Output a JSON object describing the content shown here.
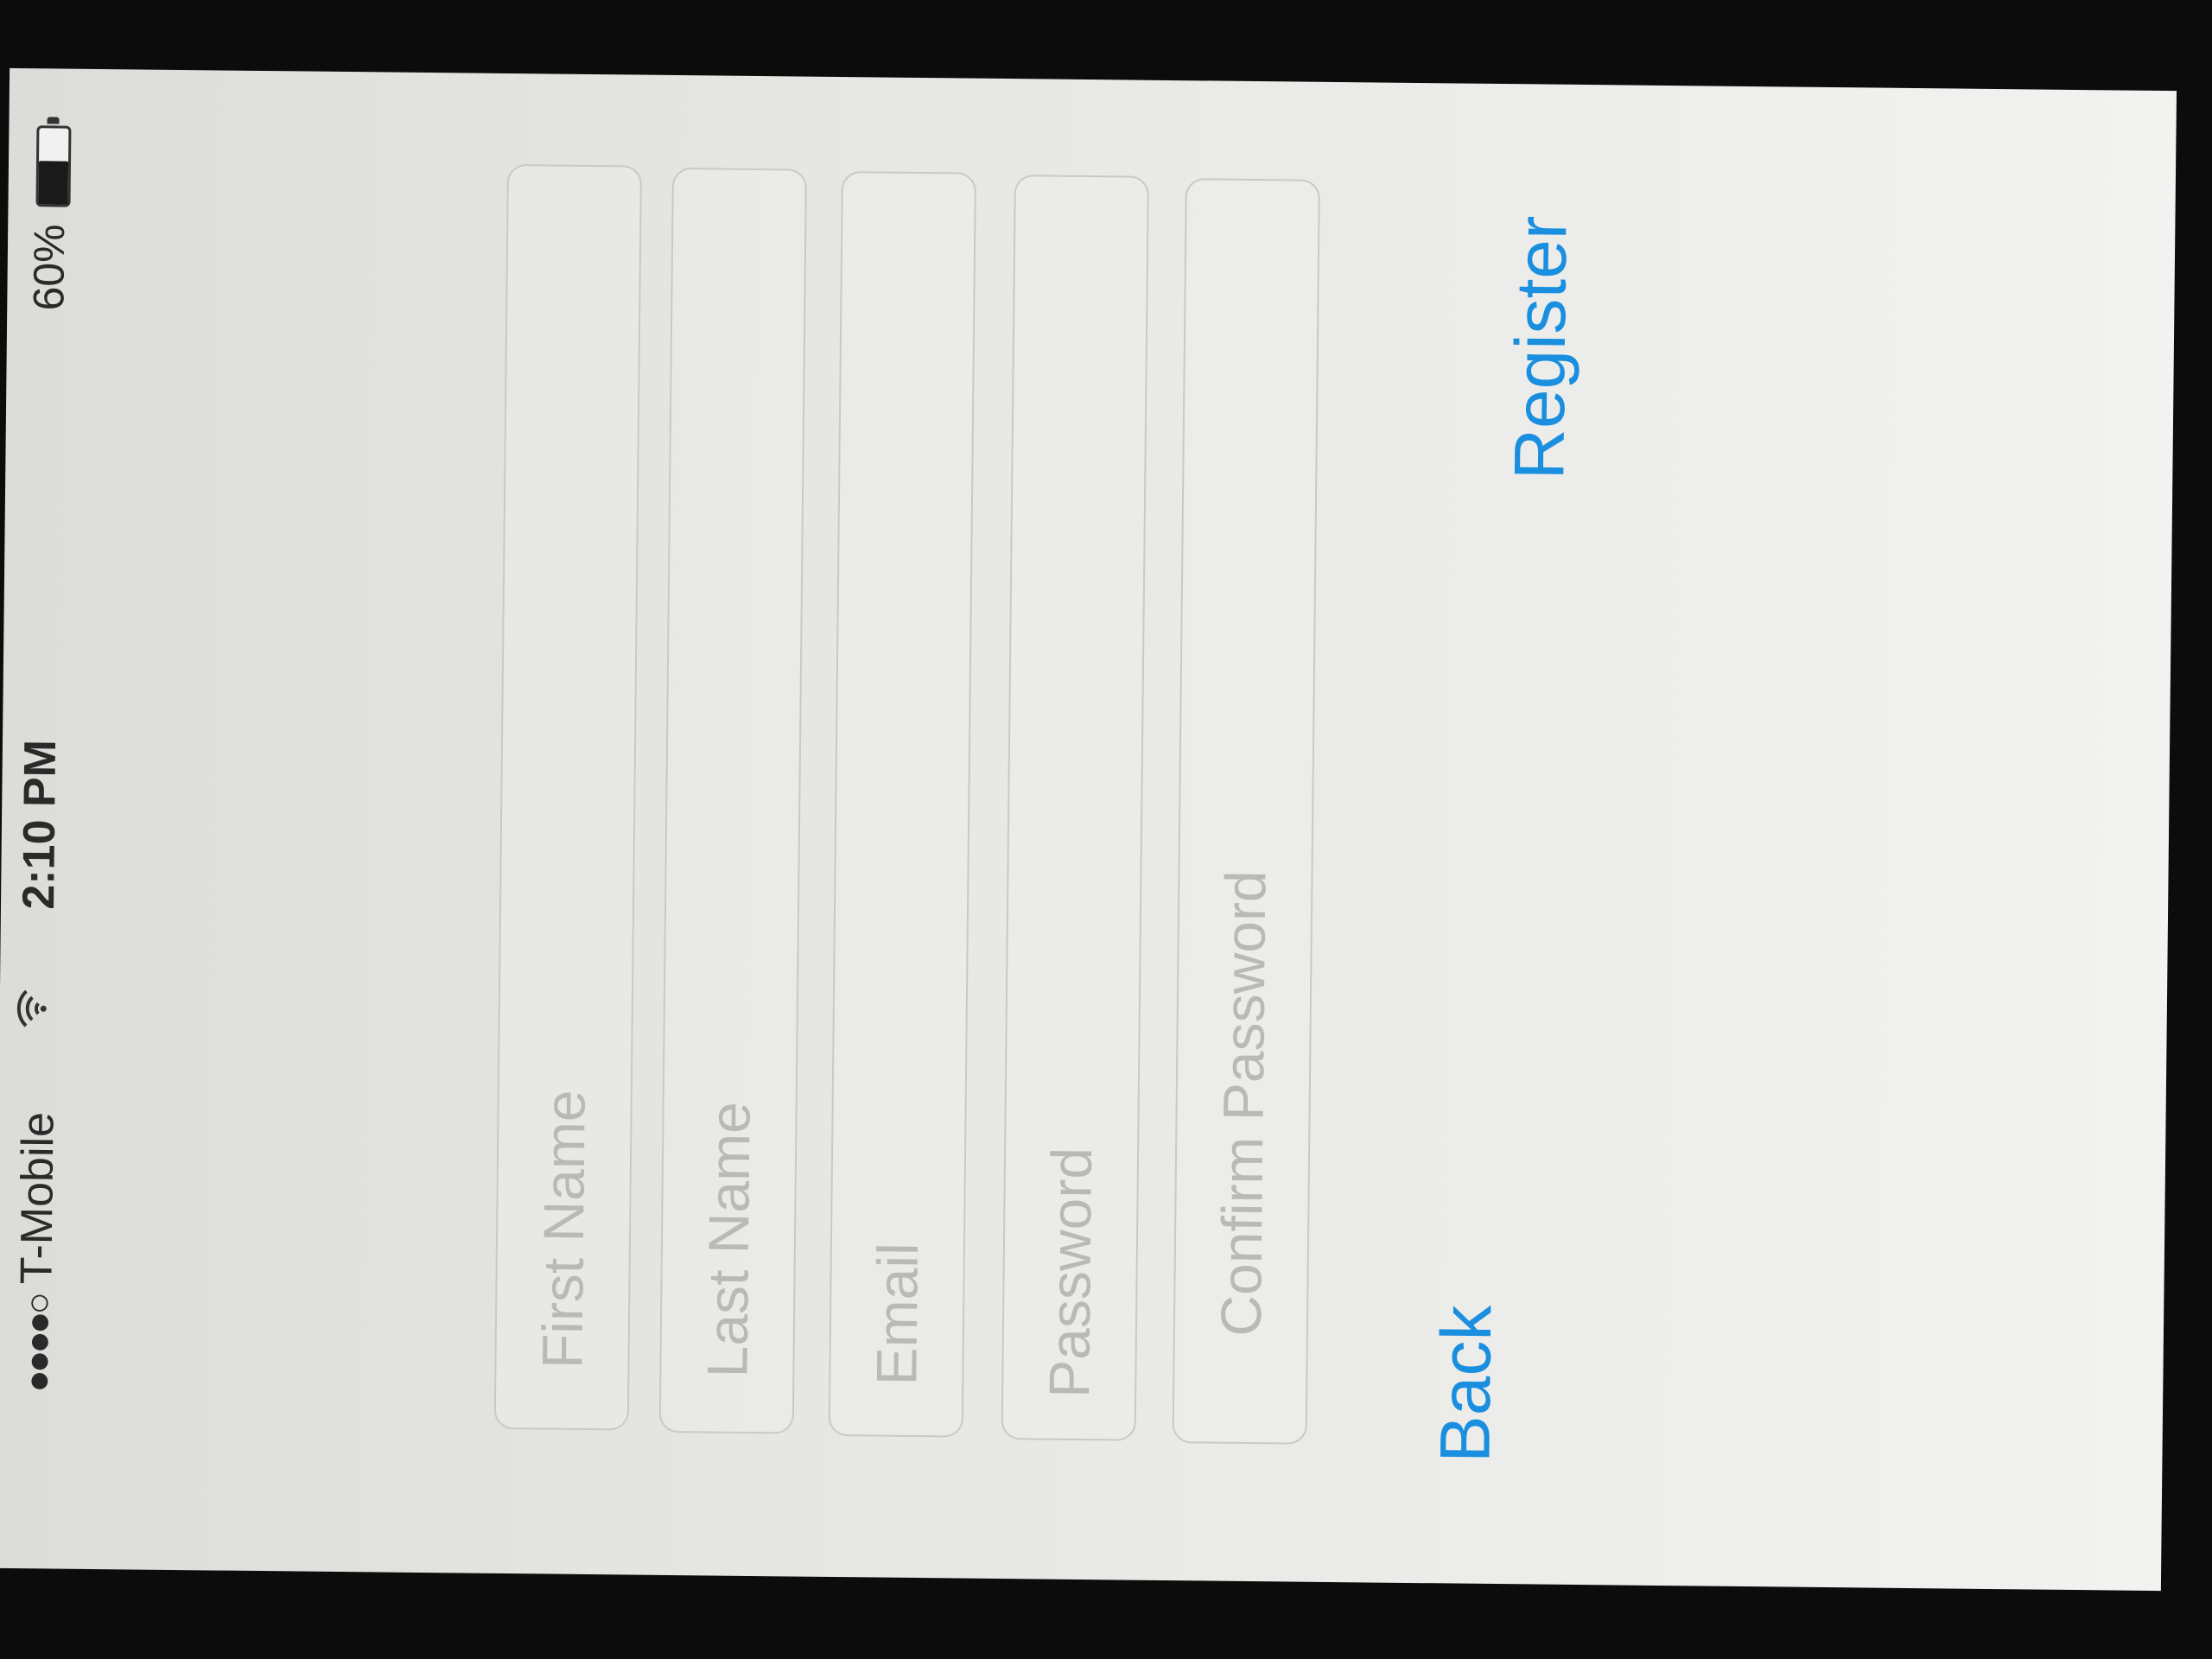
{
  "status_bar": {
    "signal": "●●●●○",
    "carrier": "T-Mobile",
    "time": "2:10 PM",
    "battery_percent": "60%",
    "battery_level": 0.6,
    "wifi_icon": "wifi-icon"
  },
  "form": {
    "first_name": {
      "placeholder": "First Name",
      "value": ""
    },
    "last_name": {
      "placeholder": "Last Name",
      "value": ""
    },
    "email": {
      "placeholder": "Email",
      "value": ""
    },
    "password": {
      "placeholder": "Password",
      "value": ""
    },
    "confirm_password": {
      "placeholder": "Confirm Password",
      "value": ""
    }
  },
  "actions": {
    "back_label": "Back",
    "register_label": "Register"
  },
  "colors": {
    "accent": "#1a8fe0",
    "placeholder": "#b9b9b6",
    "field_border": "#c9c9c6"
  }
}
